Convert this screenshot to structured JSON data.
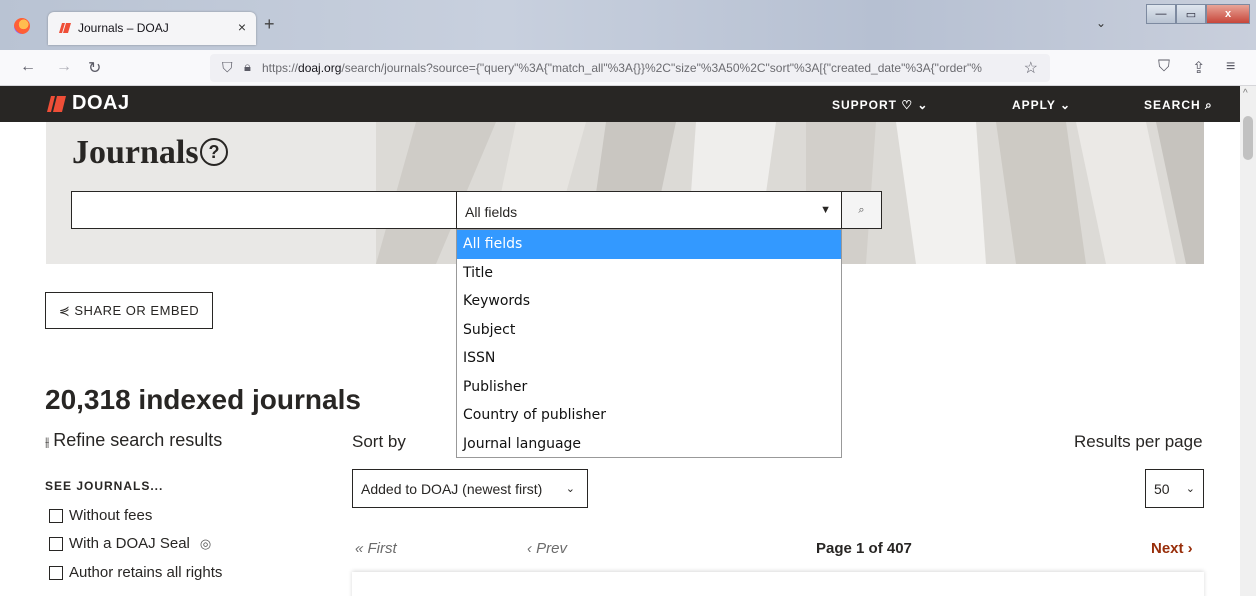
{
  "browser": {
    "tab_title": "Journals – DOAJ",
    "tab_close": "×",
    "new_tab": "+",
    "tabs_list": "⌄",
    "url_prefix": "https://",
    "url_domain": "doaj.org",
    "url_path": "/search/journals?source={\"query\"%3A{\"match_all\"%3A{}}%2C\"size\"%3A50%2C\"sort\"%3A[{\"created_date\"%3A{\"order\"%",
    "win_minimize": "—",
    "win_maximize": "▭",
    "win_close": "x"
  },
  "header": {
    "logo": "DOAJ",
    "support": "SUPPORT ♡ ⌄",
    "apply": "APPLY ⌄",
    "search": "SEARCH ⌕",
    "logo_color": "#ef4e37"
  },
  "hero": {
    "title": "Journals",
    "help": "?"
  },
  "search": {
    "placeholder": "",
    "field_selected": "All fields",
    "field_options": [
      "All fields",
      "Title",
      "Keywords",
      "Subject",
      "ISSN",
      "Publisher",
      "Country of publisher",
      "Journal language"
    ],
    "highlight_color": "#3399ff"
  },
  "share": {
    "label": "⋞ SHARE OR EMBED"
  },
  "results": {
    "count_title": "20,318 indexed journals",
    "refine_label": "Refine search results",
    "see_label": "SEE JOURNALS...",
    "facets": [
      "Without fees",
      "With a DOAJ Seal",
      "Author retains all rights"
    ],
    "sort_label": "Sort by",
    "sort_value": "Added to DOAJ (newest first)",
    "rpp_label": "Results per page",
    "rpp_value": "50"
  },
  "pagination": {
    "first": "« First",
    "prev": "‹ Prev",
    "page_info": "Page 1 of 407",
    "next": "Next ›"
  }
}
